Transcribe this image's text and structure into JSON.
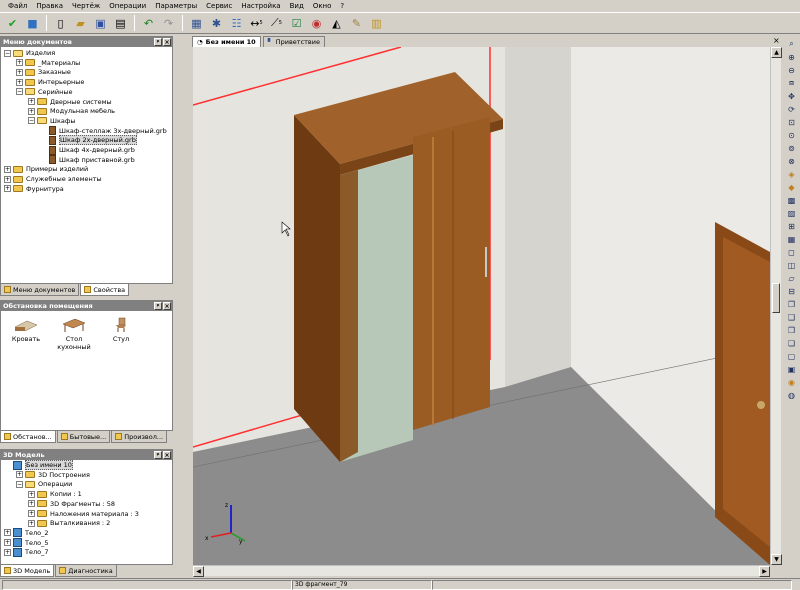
{
  "menu": [
    "Файл",
    "Правка",
    "Чертёж",
    "Операции",
    "Параметры",
    "Сервис",
    "Настройка",
    "Вид",
    "Окно",
    "?"
  ],
  "toolbar": {
    "icons": [
      "checkmark-icon",
      "cube-icon",
      "new-file-icon",
      "open-file-icon",
      "save-icon",
      "print-icon",
      "undo-icon",
      "redo-icon",
      "materials-icon",
      "settings-icon",
      "tree-icon",
      "dimension-icon",
      "line-icon",
      "check-icon",
      "library-icon",
      "reflect-icon",
      "edit-icon",
      "package-icon"
    ],
    "dim_label": "5",
    "line_label": "5"
  },
  "docmenu": {
    "title": "Меню документов",
    "items": [
      {
        "label": "Изделия",
        "level": 0,
        "pm": "−",
        "icon": "open"
      },
      {
        "label": "_Материалы",
        "level": 1,
        "pm": "+",
        "icon": "folder"
      },
      {
        "label": "Заказные",
        "level": 1,
        "pm": "+",
        "icon": "folder"
      },
      {
        "label": "Интерьерные",
        "level": 1,
        "pm": "+",
        "icon": "folder"
      },
      {
        "label": "Серийные",
        "level": 1,
        "pm": "−",
        "icon": "open"
      },
      {
        "label": "Дверные системы",
        "level": 2,
        "pm": "+",
        "icon": "folder"
      },
      {
        "label": "Модульная мебель",
        "level": 2,
        "pm": "+",
        "icon": "folder"
      },
      {
        "label": "Шкафы",
        "level": 2,
        "pm": "−",
        "icon": "open"
      },
      {
        "label": "Шкаф-стеллаж 3х-дверный.grb",
        "level": 3,
        "pm": "",
        "icon": "file"
      },
      {
        "label": "Шкаф 2х-дверный.grb",
        "level": 3,
        "pm": "",
        "icon": "file",
        "selected": true
      },
      {
        "label": "Шкаф 4х-дверный.grb",
        "level": 3,
        "pm": "",
        "icon": "file"
      },
      {
        "label": "Шкаф приставной.grb",
        "level": 3,
        "pm": "",
        "icon": "file"
      },
      {
        "label": "Примеры изделий",
        "level": 0,
        "pm": "+",
        "icon": "folder"
      },
      {
        "label": "Служебные элементы",
        "level": 0,
        "pm": "+",
        "icon": "folder"
      },
      {
        "label": "Фурнитура",
        "level": 0,
        "pm": "+",
        "icon": "folder"
      }
    ],
    "tabs": [
      "Меню документов",
      "Свойства"
    ]
  },
  "room": {
    "title": "Обстановка помещения",
    "items": [
      {
        "label": "Кровать",
        "icon": "bed-icon"
      },
      {
        "label": "Стол кухонный",
        "icon": "table-icon"
      },
      {
        "label": "Стул",
        "icon": "chair-icon"
      }
    ],
    "tabs": [
      "Обстанов...",
      "Бытовые...",
      "Произвол..."
    ]
  },
  "model": {
    "title": "3D Модель",
    "items": [
      {
        "label": "Без имени 10",
        "level": 0,
        "pm": "",
        "icon": "cube",
        "selected": true
      },
      {
        "label": "3D Построения",
        "level": 1,
        "pm": "+",
        "icon": "folder"
      },
      {
        "label": "Операции",
        "level": 1,
        "pm": "−",
        "icon": "open"
      },
      {
        "label": "Копии : 1",
        "level": 2,
        "pm": "+",
        "icon": "folder"
      },
      {
        "label": "3D Фрагменты : 58",
        "level": 2,
        "pm": "+",
        "icon": "folder"
      },
      {
        "label": "Наложения материала : 3",
        "level": 2,
        "pm": "+",
        "icon": "folder"
      },
      {
        "label": "Выталкивания : 2",
        "level": 2,
        "pm": "+",
        "icon": "folder"
      },
      {
        "label": "Тело_2",
        "level": 0,
        "pm": "+",
        "icon": "cube"
      },
      {
        "label": "Тело_5",
        "level": 0,
        "pm": "+",
        "icon": "cube"
      },
      {
        "label": "Тело_7",
        "level": 0,
        "pm": "+",
        "icon": "cube"
      }
    ],
    "tabs": [
      "3D Модель",
      "Диагностика"
    ]
  },
  "doctabs": [
    "Без имени 10",
    "Приветствие"
  ],
  "status": {
    "fragment": "3D фрагмент_79"
  },
  "colors": {
    "wall": "#e6e4df",
    "floor": "#8c8c8c",
    "wood": "#8a4e1c",
    "glass": "#b8c8b8",
    "selection": "#ff3030"
  }
}
